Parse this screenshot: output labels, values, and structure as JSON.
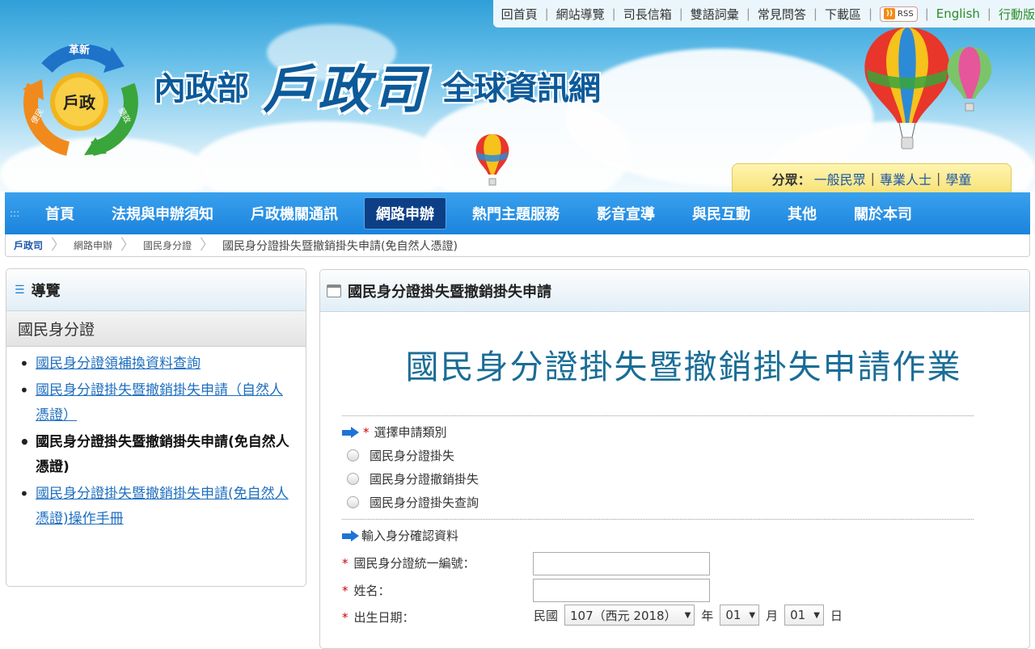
{
  "header": {
    "top_links": [
      "回首頁",
      "網站導覽",
      "司長信箱",
      "雙語詞彙",
      "常見問答",
      "下載區"
    ],
    "rss_label": "RSS",
    "english_label": "English",
    "mobile_label": "行動版",
    "logo": {
      "top": "革新",
      "center": "戶政",
      "left": "便民",
      "right": "簡政"
    },
    "title_part1": "內政部",
    "title_part2": "戶政司",
    "title_part3": "全球資訊網",
    "audience_label": "分眾：",
    "audience_links": [
      "一般民眾",
      "專業人士",
      "學童"
    ]
  },
  "nav": {
    "items": [
      "首頁",
      "法規與申辦須知",
      "戶政機關通訊",
      "網路申辦",
      "熱門主題服務",
      "影音宣導",
      "與民互動",
      "其他",
      "關於本司"
    ],
    "active_index": 3
  },
  "breadcrumb": {
    "items": [
      "戶政司",
      "網路申辦",
      "國民身分證"
    ],
    "current": "國民身分證掛失暨撤銷掛失申請(免自然人憑證)"
  },
  "sidebar": {
    "title": "導覽",
    "group": "國民身分證",
    "items": [
      {
        "label": "國民身分證領補換資料查詢",
        "current": false
      },
      {
        "label": "國民身分證掛失暨撤銷掛失申請（自然人憑證）",
        "current": false
      },
      {
        "label": "國民身分證掛失暨撤銷掛失申請(免自然人憑證)",
        "current": true
      },
      {
        "label": "國民身分證掛失暨撤銷掛失申請(免自然人憑證)操作手冊",
        "current": false
      }
    ]
  },
  "main": {
    "panel_title": "國民身分證掛失暨撤銷掛失申請",
    "heading": "國民身分證掛失暨撤銷掛失申請作業",
    "section1_required": "*",
    "section1_label": "選擇申請類別",
    "options": [
      "國民身分證掛失",
      "國民身分證撤銷掛失",
      "國民身分證掛失查詢"
    ],
    "section2_label": "輸入身分確認資料",
    "fields": [
      {
        "label": "國民身分證統一編號：",
        "value": ""
      },
      {
        "label": "姓名：",
        "value": ""
      },
      {
        "label": "出生日期：",
        "value": ""
      }
    ],
    "dob": {
      "era_prefix": "民國",
      "year_value": "107（西元 2018）",
      "year_unit": "年",
      "month_value": "01",
      "month_unit": "月",
      "day_value": "01",
      "day_unit": "日"
    }
  },
  "colors": {
    "nav_bg": "#1b83dc",
    "nav_active": "#0d3f86",
    "heading": "#1a6d96",
    "link": "#1f6fbf",
    "required": "#d30000"
  }
}
